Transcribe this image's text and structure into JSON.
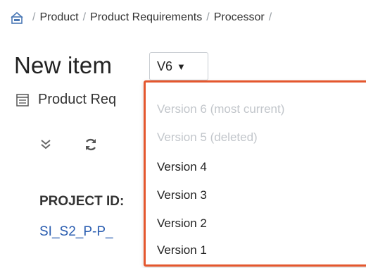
{
  "breadcrumb": {
    "items": [
      "Product",
      "Product Requirements",
      "Processor"
    ]
  },
  "title": "New item",
  "version_select": {
    "value": "V6"
  },
  "subtitle": "Product Req",
  "toolbar": {
    "expand_icon": "double-chevron-down-icon",
    "refresh_icon": "refresh-icon"
  },
  "project": {
    "label": "PROJECT ID:",
    "value": "SI_S2_P-P_"
  },
  "version_menu": {
    "items": [
      {
        "label": "Version 6 (most current)",
        "disabled": true
      },
      {
        "label": "Version 5 (deleted)",
        "disabled": true
      },
      {
        "label": "Version 4",
        "disabled": false
      },
      {
        "label": "Version 3",
        "disabled": false
      },
      {
        "label": "Version 2",
        "disabled": false
      },
      {
        "label": "Version 1",
        "disabled": false
      }
    ]
  },
  "colors": {
    "menu_border": "#e4572e",
    "link": "#2a5db0",
    "disabled_text": "#c2c6cb"
  }
}
